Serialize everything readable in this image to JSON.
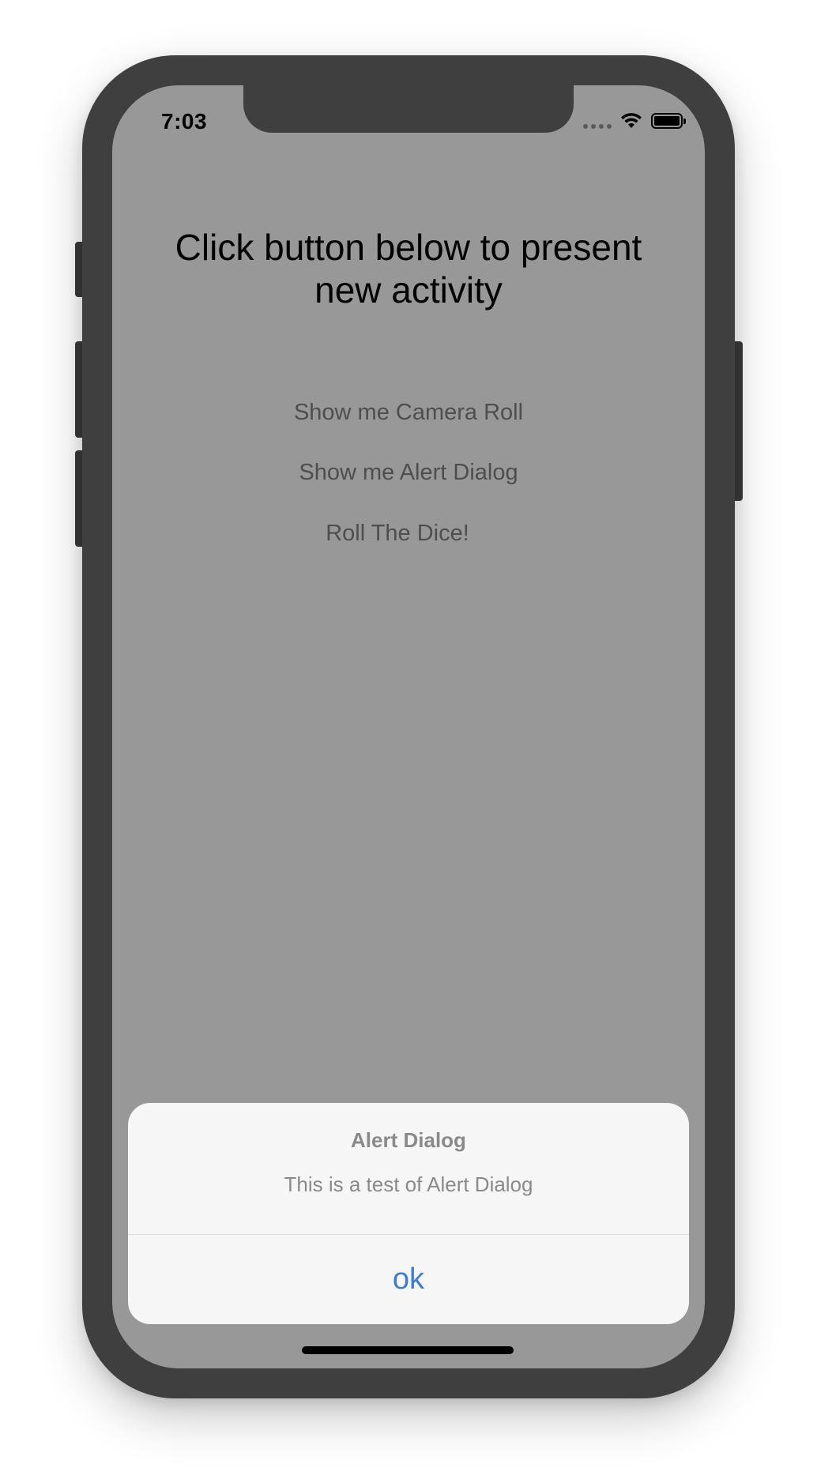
{
  "status_bar": {
    "time": "7:03",
    "icons": [
      "cellular-signal-icon",
      "wifi-icon",
      "battery-icon"
    ]
  },
  "main": {
    "title": "Click button below to present new activity",
    "buttons": [
      {
        "label": "Show me Camera Roll"
      },
      {
        "label": "Show me Alert Dialog"
      },
      {
        "label": "Roll The Dice!"
      }
    ]
  },
  "alert": {
    "title": "Alert Dialog",
    "message": "This is a test of Alert Dialog",
    "ok_label": "ok"
  },
  "colors": {
    "screen_background": "#989898",
    "frame": "#3f3f3f",
    "alert_background": "#f6f6f6",
    "alert_action": "#3b7cd9"
  }
}
